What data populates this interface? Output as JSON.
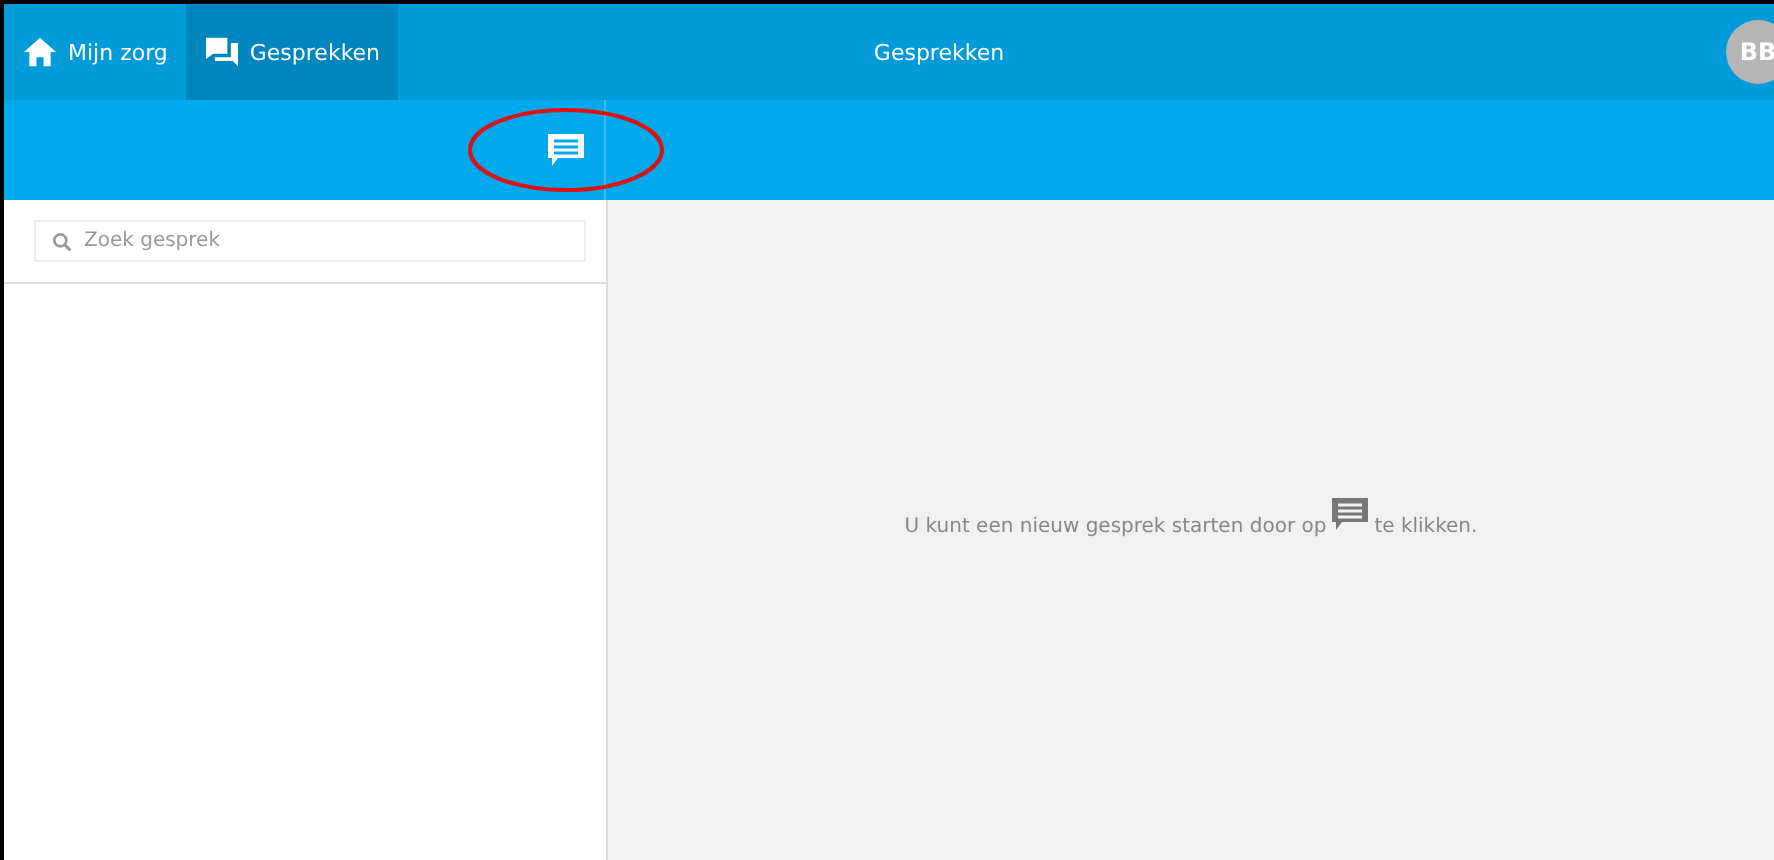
{
  "nav": [
    {
      "label": "Mijn zorg",
      "kind": "home",
      "selected": false
    },
    {
      "label": "Gesprekken",
      "kind": "chat",
      "selected": true
    }
  ],
  "title": "Gesprekken",
  "avatar": "BB",
  "search": {
    "placeholder": "Zoek gesprek"
  },
  "empty_message": {
    "before": "U kunt een nieuw gesprek starten door op",
    "after": "te klikken."
  }
}
